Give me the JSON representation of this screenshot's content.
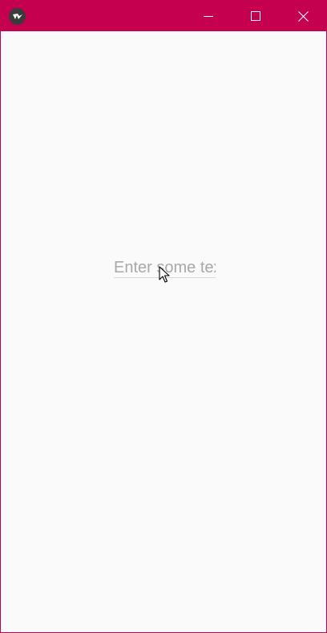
{
  "window": {
    "accent_color": "#c4004f",
    "background_color": "#fafafa",
    "app_icon": "kivy-logo-icon",
    "controls": {
      "minimize_icon": "minimize-icon",
      "maximize_icon": "maximize-icon",
      "close_icon": "close-icon"
    }
  },
  "input": {
    "value": "",
    "placeholder": "Enter some text"
  }
}
